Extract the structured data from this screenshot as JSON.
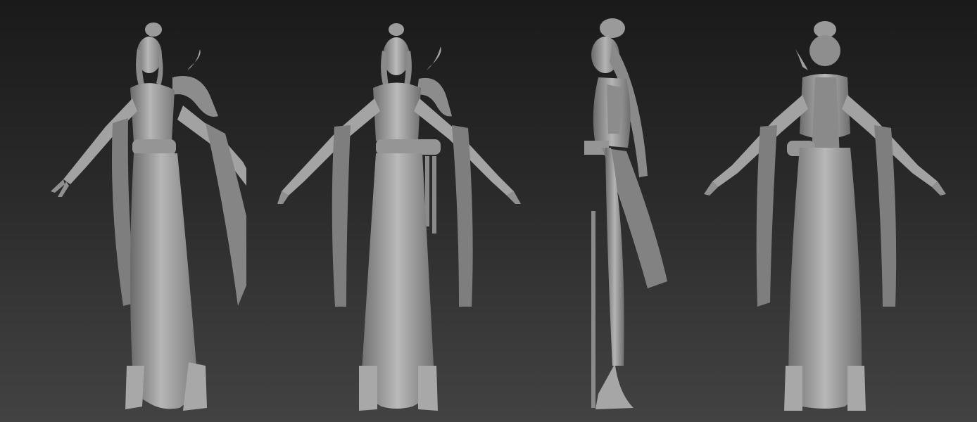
{
  "scene": {
    "description_views": [
      "front-three-quarter",
      "front",
      "side",
      "back"
    ],
    "colors": {
      "background_top": "#1a1a1a",
      "background_bottom": "#424242",
      "clay_light": "#b4b4b4",
      "clay_mid": "#8e8e8e",
      "clay_dark": "#5e5e5e"
    }
  }
}
